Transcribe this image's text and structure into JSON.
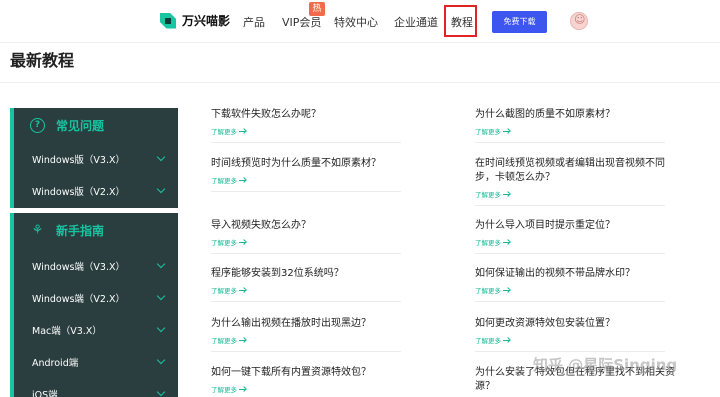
{
  "nav": {
    "logo_text": "万兴喵影",
    "items": [
      "产品",
      "VIP会员",
      "特效中心",
      "企业通道",
      "教程"
    ],
    "hot_badge": "热",
    "download_label": "免费下载",
    "accent_color": "#3e56f0"
  },
  "page": {
    "title": "最新教程"
  },
  "sidebar": {
    "groups": [
      {
        "title": "常见问题",
        "icon": "question-circle-icon",
        "items": [
          "Windows版（V3.X）",
          "Windows版（V2.X）"
        ]
      },
      {
        "title": "新手指南",
        "icon": "sprout-icon",
        "items": [
          "Windows端（V3.X）",
          "Windows端（V2.X）",
          "Mac端（V3.X）",
          "Android端",
          "iOS端"
        ]
      }
    ],
    "accent_color": "#16c4a1",
    "background_color": "#2b3e3f"
  },
  "articles": {
    "more_label": "了解更多",
    "left": [
      "下载软件失败怎么办呢？",
      "时间线预览时为什么质量不如原素材？",
      "导入视频失败怎么办？",
      "程序能够安装到32位系统吗？",
      "为什么输出视频在播放时出现黑边？",
      "如何一键下载所有内置资源特效包？"
    ],
    "right": [
      "为什么截图的质量不如原素材？",
      "在时间线预览视频或者编辑出现音视频不同步，卡顿怎么办？",
      "为什么导入项目时提示重定位？",
      "如何保证输出的视频不带品牌水印？",
      "如何更改资源特效包安装位置？",
      "为什么安装了特效包但在程序里找不到相关资源？"
    ]
  },
  "watermark": "知乎 @星际Singing"
}
